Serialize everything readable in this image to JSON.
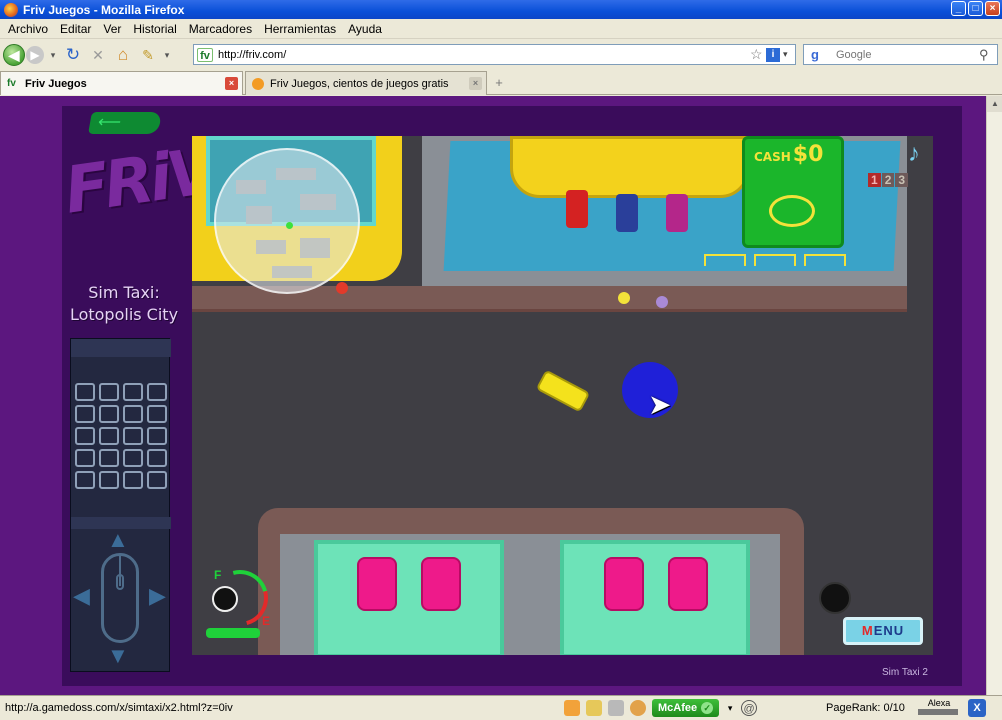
{
  "window": {
    "title": "Friv Juegos - Mozilla Firefox",
    "minimize": "_",
    "maximize": "□",
    "close": "×"
  },
  "menu": [
    "Archivo",
    "Editar",
    "Ver",
    "Historial",
    "Marcadores",
    "Herramientas",
    "Ayuda"
  ],
  "nav": {
    "back_icon": "◀",
    "forward_icon": "▶",
    "reload_icon": "↻",
    "stop_icon": "✕",
    "home_icon": "⌂",
    "bookmark_icon": "✎",
    "dropdown_icon": "▾",
    "url_favicon": "fv",
    "url": "http://friv.com/",
    "star_icon": "☆",
    "info_icon": "i",
    "search_engine": "g",
    "search_placeholder": "Google",
    "search_icon": "⚲"
  },
  "tabs": [
    {
      "label": "Friv Juegos",
      "favicon": "fv",
      "active": true
    },
    {
      "label": "Friv Juegos, cientos de juegos gratis",
      "favicon": "",
      "active": false
    }
  ],
  "tab_close_icon": "×",
  "new_tab_icon": "+",
  "page": {
    "back_arrow": "⟵",
    "logo_text": "FRiV",
    "game_title_line1": "Sim Taxi:",
    "game_title_line2": "Lotopolis City",
    "footer_label": "Sim Taxi 2"
  },
  "game": {
    "cash_label": "CASH",
    "cash_value": "$0",
    "music_icon": "♪",
    "pages": [
      "1",
      "2",
      "3"
    ],
    "current_page": "1",
    "fuel_full": "F",
    "fuel_empty": "E",
    "menu_button": "MENU",
    "cursor_icon": "➤"
  },
  "status": {
    "url": "http://a.gamedoss.com/x/simtaxi/x2.html?z=0iv",
    "mcafee": "McAfee",
    "pagerank": "PageRank: 0/10",
    "alexa": "Alexa",
    "x_icon": "X"
  },
  "colors": {
    "titlebar": "#0A50D8",
    "page_bg": "#5c177f",
    "accent_green": "#1bb62b",
    "cash_yellow": "#f3e23a"
  }
}
